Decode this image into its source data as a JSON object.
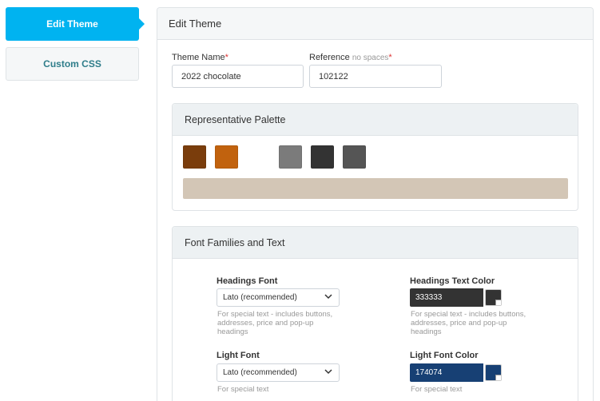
{
  "sidebar": {
    "items": [
      {
        "label": "Edit Theme"
      },
      {
        "label": "Custom CSS"
      }
    ]
  },
  "header": {
    "title": "Edit Theme"
  },
  "form": {
    "theme_name": {
      "label": "Theme Name",
      "required_mark": "*",
      "value": "2022 chocolate"
    },
    "reference": {
      "label": "Reference",
      "hint": "no spaces",
      "required_mark": "*",
      "value": "102122"
    }
  },
  "palette": {
    "title": "Representative Palette",
    "swatches": [
      "#7a3d0c",
      "#c1620e",
      "#7b7b7b",
      "#333333",
      "#555555"
    ],
    "bar_color": "#d3c6b6"
  },
  "fonts": {
    "title": "Font Families and Text",
    "headings_font": {
      "label": "Headings Font",
      "value": "Lato (recommended)",
      "help": "For special text - includes buttons, addresses, price and pop-up headings"
    },
    "headings_color": {
      "label": "Headings Text Color",
      "value": "333333",
      "hex": "#333333",
      "help": "For special text - includes buttons, addresses, price and pop-up headings"
    },
    "light_font": {
      "label": "Light Font",
      "value": "Lato (recommended)",
      "help": "For special text"
    },
    "light_color": {
      "label": "Light Font Color",
      "value": "174074",
      "hex": "#174074",
      "help": "For special text"
    }
  }
}
